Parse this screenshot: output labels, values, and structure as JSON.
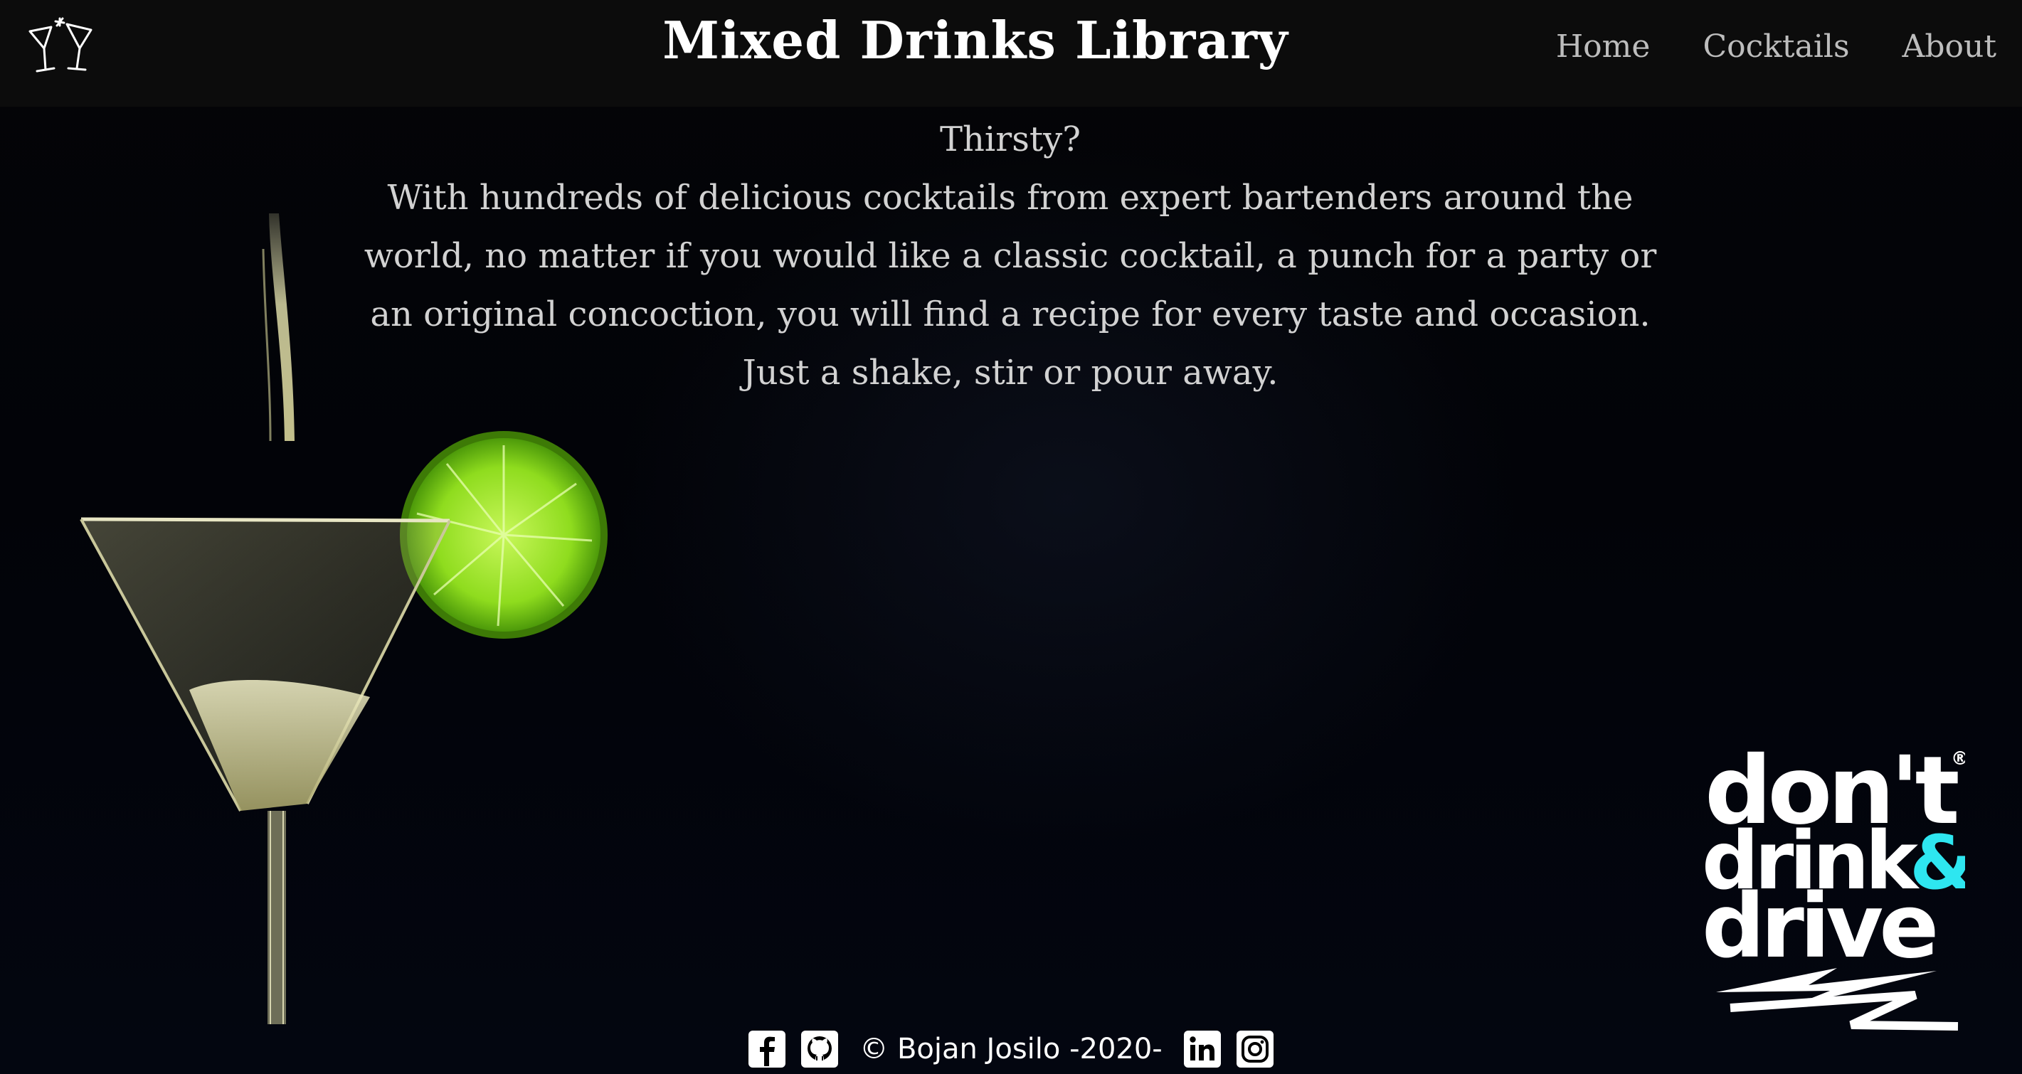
{
  "header": {
    "title": "Mixed Drinks Library",
    "logo_icon": "cocktail-glasses-icon"
  },
  "nav": {
    "items": [
      {
        "label": "Home"
      },
      {
        "label": "Cocktails"
      },
      {
        "label": "About"
      }
    ]
  },
  "intro": {
    "heading": "Thirsty?",
    "body": "With hundreds of delicious cocktails from expert bartenders around the world, no matter if you would like a classic cocktail, a punch for a party or an original concoction, you will find a recipe for every taste and occasion. Just a shake, stir or pour away."
  },
  "badge": {
    "line1": "don't",
    "line2": "drink",
    "amp": "&",
    "line3": "drive",
    "registered": "®"
  },
  "footer": {
    "copyright": "© Bojan Josilo -2020-",
    "social": [
      "facebook-icon",
      "github-icon",
      "linkedin-icon",
      "instagram-icon"
    ]
  },
  "colors": {
    "header_bg": "#0c0c0c",
    "page_bg": "#020306",
    "text": "#d2d2d2",
    "lime": "#7fd318",
    "accent_cyan": "#2ee6f0"
  }
}
